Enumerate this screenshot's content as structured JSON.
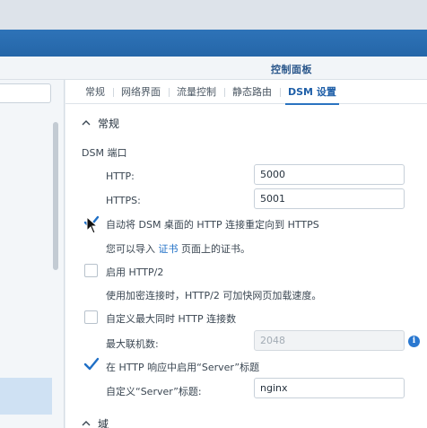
{
  "window": {
    "title": "控制面板"
  },
  "tabs": [
    {
      "label": "常规",
      "active": false
    },
    {
      "label": "网络界面",
      "active": false
    },
    {
      "label": "流量控制",
      "active": false
    },
    {
      "label": "静态路由",
      "active": false
    },
    {
      "label": "DSM 设置",
      "active": true
    }
  ],
  "sections": {
    "general": {
      "title": "常规"
    },
    "domain": {
      "title": "域"
    }
  },
  "dsm_port": {
    "heading": "DSM 端口",
    "http_label": "HTTP:",
    "http_value": "5000",
    "https_label": "HTTPS:",
    "https_value": "5001"
  },
  "redirect": {
    "label": "自动将 DSM 桌面的 HTTP 连接重定向到 HTTPS",
    "checked": true,
    "hint_before": "您可以导入",
    "hint_link": "证书",
    "hint_after": "页面上的证书。"
  },
  "http2": {
    "label": "启用 HTTP/2",
    "checked": false,
    "hint": "使用加密连接时，HTTP/2 可加快网页加载速度。"
  },
  "max_connections": {
    "label": "自定义最大同时 HTTP 连接数",
    "checked": false,
    "field_label": "最大联机数:",
    "value": "2048"
  },
  "server_header": {
    "label": "在 HTTP 响应中启用“Server”标题",
    "checked": true,
    "field_label": "自定义“Server”标题:",
    "value": "nginx"
  },
  "colors": {
    "accent": "#2a73c0",
    "header_blue": "#2566a8",
    "check_blue": "#1f6fc6"
  }
}
